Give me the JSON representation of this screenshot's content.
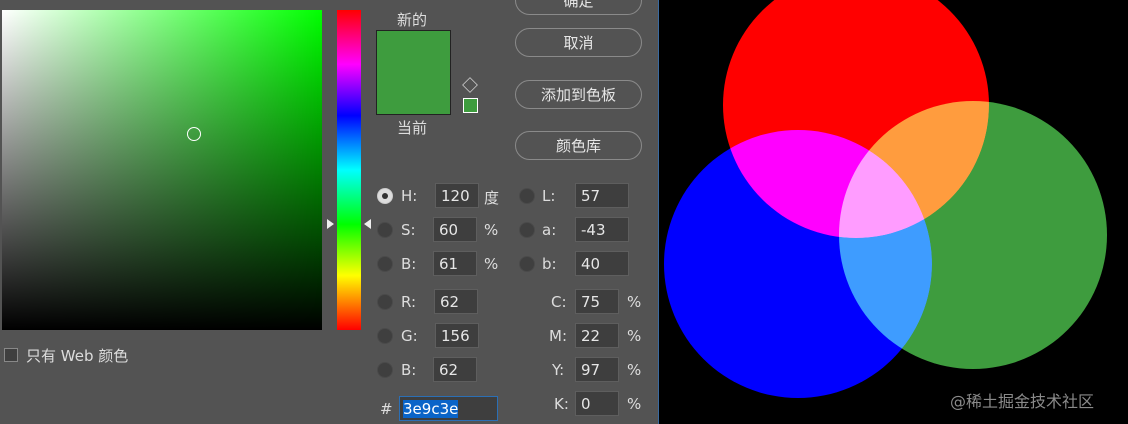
{
  "dialog": {
    "new_label": "新的",
    "current_label": "当前",
    "new_color": "#3e9c3e",
    "current_color": "#3e9c3e",
    "buttons": {
      "ok": "确定",
      "cancel": "取消",
      "add_swatch": "添加到色板",
      "library": "颜色库"
    },
    "web_only": "只有 Web 颜色",
    "fields": {
      "H": {
        "label": "H:",
        "value": "120",
        "unit": "度"
      },
      "S": {
        "label": "S:",
        "value": "60",
        "unit": "%"
      },
      "Bv": {
        "label": "B:",
        "value": "61",
        "unit": "%"
      },
      "R": {
        "label": "R:",
        "value": "62"
      },
      "G": {
        "label": "G:",
        "value": "156"
      },
      "Bl": {
        "label": "B:",
        "value": "62"
      },
      "L": {
        "label": "L:",
        "value": "57"
      },
      "a": {
        "label": "a:",
        "value": "-43"
      },
      "b": {
        "label": "b:",
        "value": "40"
      },
      "C": {
        "label": "C:",
        "value": "75",
        "unit": "%"
      },
      "M": {
        "label": "M:",
        "value": "22",
        "unit": "%"
      },
      "Y": {
        "label": "Y:",
        "value": "97",
        "unit": "%"
      },
      "K": {
        "label": "K:",
        "value": "0",
        "unit": "%"
      }
    },
    "hex_label": "#",
    "hex": "3e9c3e"
  },
  "canvas": {
    "colors": {
      "red": "#ff0000",
      "blue": "#0000ff",
      "green": "#3e9c3e"
    },
    "watermark": "@稀土掘金技术社区"
  }
}
